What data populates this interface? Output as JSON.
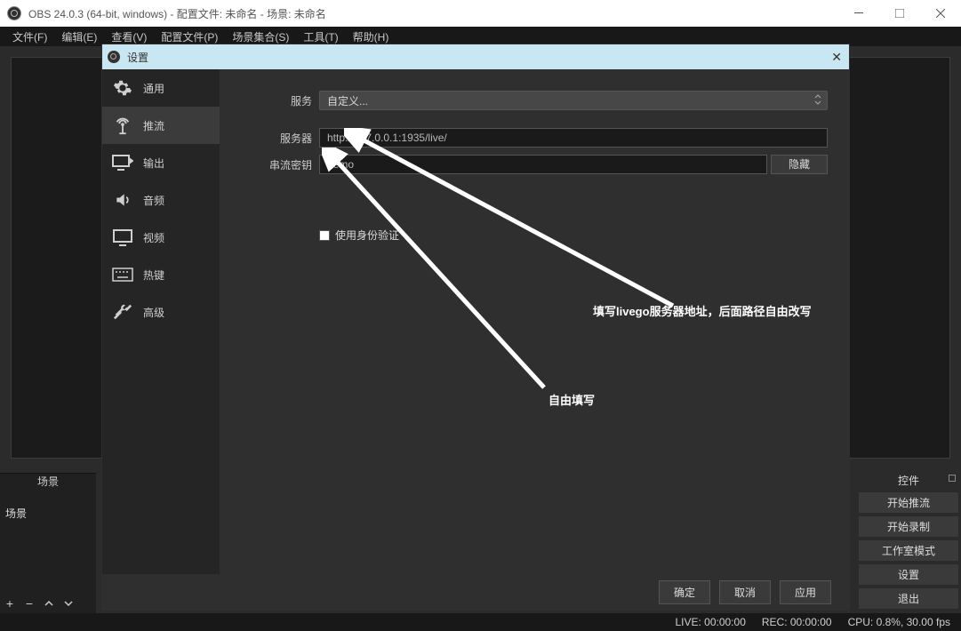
{
  "titlebar": {
    "title": "OBS 24.0.3 (64-bit, windows) - 配置文件: 未命名 - 场景: 未命名"
  },
  "menubar": {
    "items": [
      "文件(F)",
      "编辑(E)",
      "查看(V)",
      "配置文件(P)",
      "场景集合(S)",
      "工具(T)",
      "帮助(H)"
    ]
  },
  "scenes": {
    "header": "场景",
    "item": "场景"
  },
  "rightpanel": {
    "header": "控件",
    "buttons": [
      "开始推流",
      "开始录制",
      "工作室模式",
      "设置",
      "退出"
    ]
  },
  "status": {
    "live": "LIVE: 00:00:00",
    "rec": "REC: 00:00:00",
    "cpu": "CPU: 0.8%, 30.00 fps"
  },
  "dialog": {
    "title": "设置",
    "sidebar": [
      "通用",
      "推流",
      "输出",
      "音频",
      "视频",
      "热键",
      "高级"
    ],
    "labels": {
      "service": "服务",
      "server": "服务器",
      "key": "串流密钥",
      "auth": "使用身份验证"
    },
    "values": {
      "service": "自定义...",
      "server": "http://127.0.0.1:1935/live/",
      "key": "demo"
    },
    "hide": "隐藏",
    "footer": {
      "ok": "确定",
      "cancel": "取消",
      "apply": "应用"
    }
  },
  "annotations": {
    "server": "填写livego服务器地址，后面路径自由改写",
    "key": "自由填写"
  }
}
